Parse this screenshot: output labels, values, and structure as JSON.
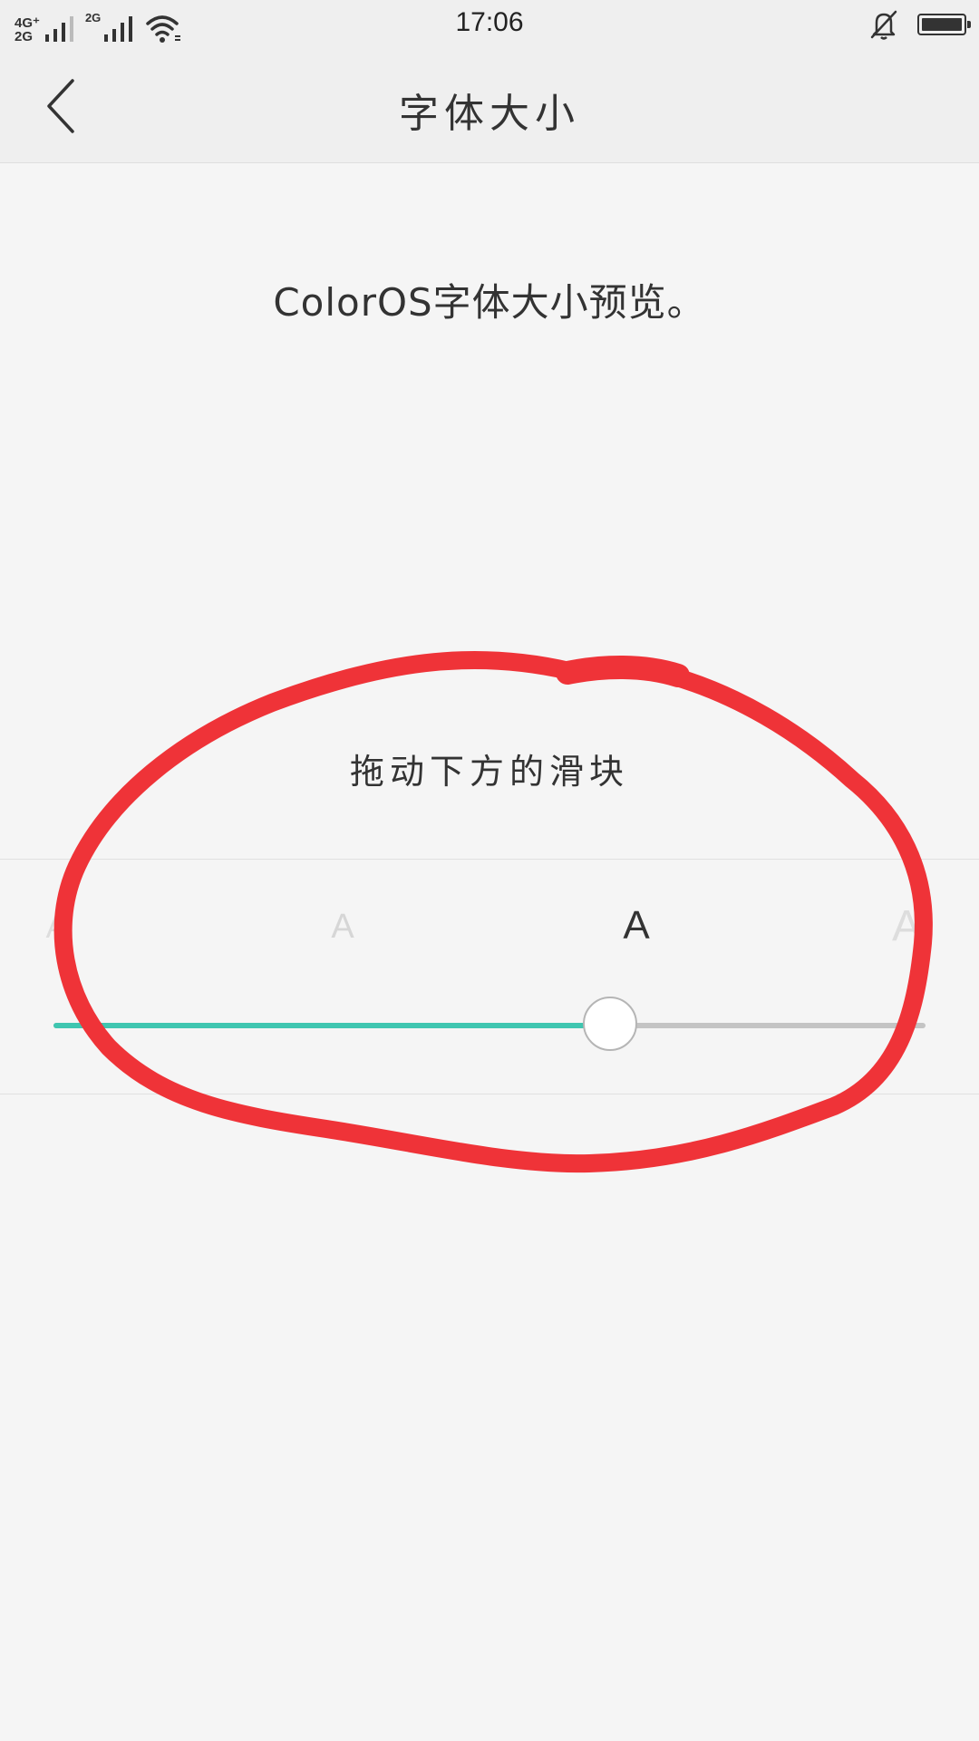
{
  "status_bar": {
    "network_top": "4G⁺",
    "network_bottom": "2G",
    "network_second": "2G",
    "time": "17:06"
  },
  "toolbar": {
    "title": "字体大小"
  },
  "preview": {
    "text": "ColorOS字体大小预览。"
  },
  "hint": {
    "text": "拖动下方的滑块"
  },
  "slider": {
    "labels": [
      "A",
      "A",
      "A",
      "A"
    ],
    "selected_index": 2,
    "value_fraction": 0.6383,
    "accent_color": "#3fc6b0"
  },
  "annotation": {
    "color": "#ef3338"
  }
}
